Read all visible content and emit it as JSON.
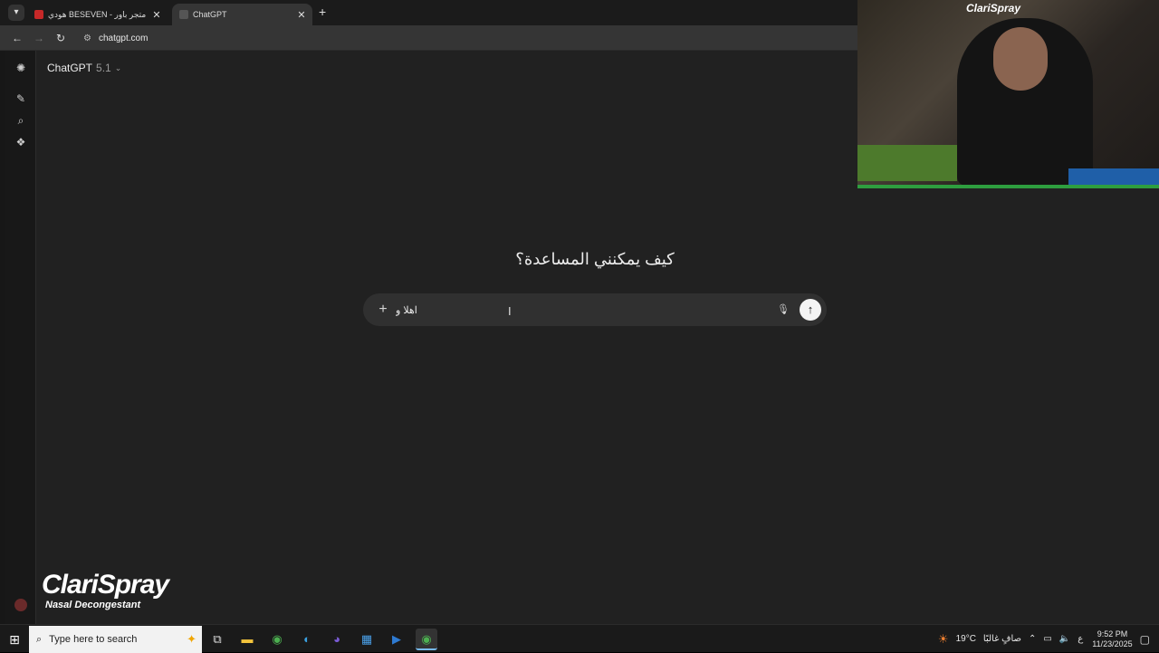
{
  "browser": {
    "tabs": [
      {
        "title": "هودي BESEVEN - متجر باور - ore",
        "favicon_color": "#c62828",
        "active": false
      },
      {
        "title": "ChatGPT",
        "favicon_color": "#555555",
        "active": true
      }
    ],
    "url": "chatgpt.com",
    "icons": {
      "tab_menu": "chevron-down-icon",
      "close": "close-icon",
      "new_tab": "plus-icon",
      "back": "arrow-left-icon",
      "forward": "arrow-right-icon",
      "reload": "reload-icon",
      "site_info": "site-info-icon"
    }
  },
  "app": {
    "model_name": "ChatGPT",
    "model_version": "5.1",
    "heading": "كيف يمكنني المساعدة؟",
    "composer": {
      "value": "اهلا و",
      "placeholder": ""
    },
    "rail_icons": [
      "openai-logo-icon",
      "new-chat-icon",
      "search-icon",
      "gpts-icon"
    ]
  },
  "overlays": {
    "webcam_brand": "ClariSpray",
    "brand_name": "ClariSpray",
    "brand_tagline": "Nasal Decongestant"
  },
  "taskbar": {
    "search_placeholder": "Type here to search",
    "temperature": "19°C",
    "weather_text": "صافٍ غالبًا",
    "language": "ع",
    "time": "9:52 PM",
    "date": "11/23/2025"
  }
}
